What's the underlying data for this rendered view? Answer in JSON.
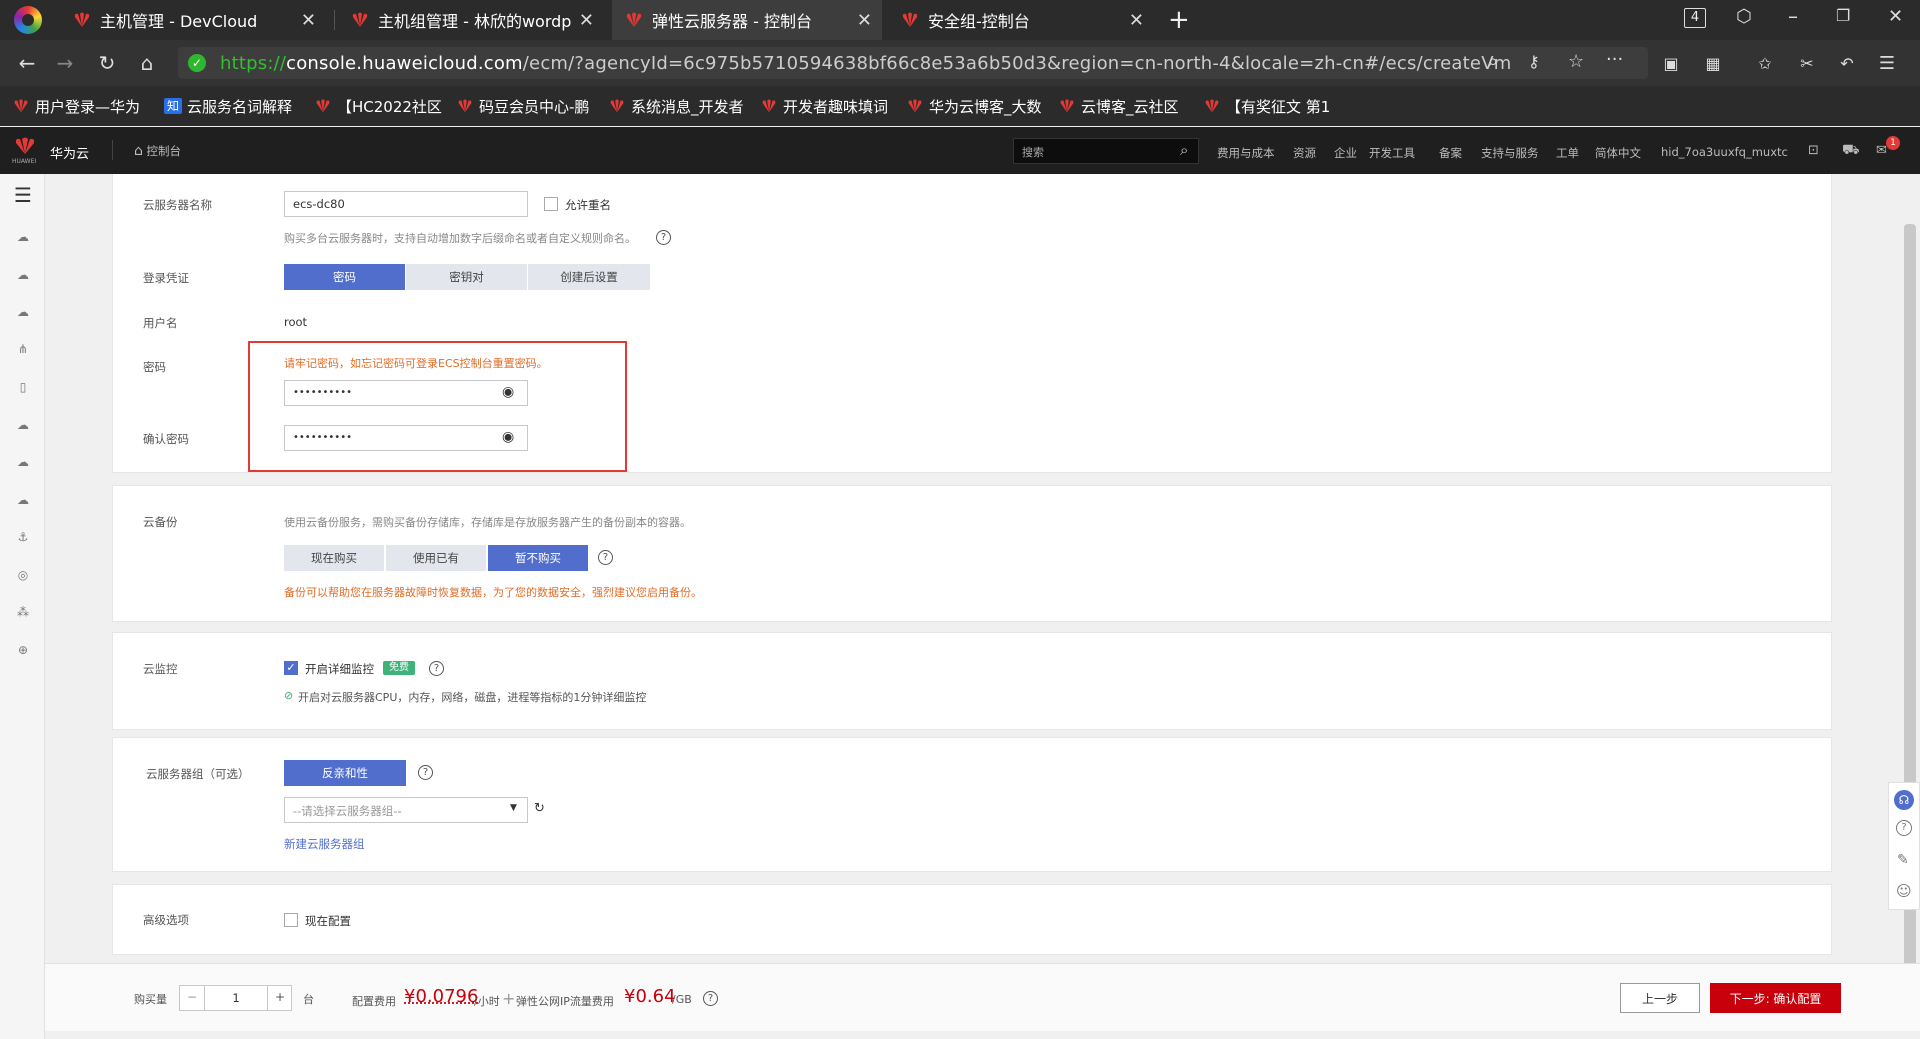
{
  "browser": {
    "tabs": [
      {
        "title": "主机管理 - DevCloud"
      },
      {
        "title": "主机组管理 - 林欣的wordpre"
      },
      {
        "title": "弹性云服务器 - 控制台"
      },
      {
        "title": "安全组-控制台"
      }
    ],
    "tab_count": "4",
    "url_scheme": "https://",
    "url_host": "console.huaweicloud.com",
    "url_rest": "/ecm/?agencyId=6c975b5710594638bf66c8e53a6b50d3&region=cn-north-4&locale=zh-cn#/ecs/createVm",
    "bookmarks": [
      "用户登录—华为",
      "云服务名词解释",
      "【HC2022社区",
      "码豆会员中心-鹏",
      "系统消息_开发者",
      "开发者趣味填词",
      "华为云博客_大数",
      "云博客_云社区",
      "【有奖征文 第1"
    ]
  },
  "console": {
    "brand": "华为云",
    "logo_small": "HUAWEI",
    "home_label": "控制台",
    "search_placeholder": "搜索",
    "links": [
      "费用与成本",
      "资源",
      "企业",
      "开发工具",
      "备案",
      "支持与服务",
      "工单",
      "简体中文",
      "hid_7oa3uuxfq_muxtc"
    ],
    "badge": "1"
  },
  "form": {
    "server_name": {
      "label": "云服务器名称",
      "value": "ecs-dc80",
      "allow_dup_label": "允许重名",
      "hint": "购买多台云服务器时，支持自动增加数字后缀命名或者自定义规则命名。"
    },
    "login": {
      "label": "登录凭证",
      "options": [
        "密码",
        "密钥对",
        "创建后设置"
      ],
      "selected": "密码"
    },
    "username": {
      "label": "用户名",
      "value": "root"
    },
    "password": {
      "label": "密码",
      "warning": "请牢记密码，如忘记密码可登录ECS控制台重置密码。",
      "value": "••••••••••"
    },
    "confirm_password": {
      "label": "确认密码",
      "value": "••••••••••"
    },
    "backup": {
      "label": "云备份",
      "desc": "使用云备份服务，需购买备份存储库，存储库是存放服务器产生的备份副本的容器。",
      "options": [
        "现在购买",
        "使用已有",
        "暂不购买"
      ],
      "selected": "暂不购买",
      "warning": "备份可以帮助您在服务器故障时恢复数据，为了您的数据安全，强烈建议您启用备份。"
    },
    "monitor": {
      "label": "云监控",
      "check_label": "开启详细监控",
      "free_badge": "免费",
      "desc": "开启对云服务器CPU，内存，网络，磁盘，进程等指标的1分钟详细监控"
    },
    "group": {
      "label": "云服务器组（可选）",
      "button": "反亲和性",
      "select_placeholder": "--请选择云服务器组--",
      "new_link": "新建云服务器组"
    },
    "advanced": {
      "label": "高级选项",
      "check_label": "现在配置"
    }
  },
  "bottom": {
    "qty_label": "购买量",
    "qty_value": "1",
    "qty_unit": "台",
    "fee_label": "配置费用",
    "price": "¥0.0796",
    "price_unit": "/小时",
    "plus": "+",
    "ip_fee_label": "弹性公网IP流量费用",
    "ip_price": "¥0.64",
    "ip_unit": "/GB",
    "prev_button": "上一步",
    "next_button": "下一步: 确认配置"
  },
  "colors": {
    "accent": "#526ecc",
    "brand_red": "#c7000b",
    "warning": "#e06d28",
    "highlight_box": "#e53935"
  }
}
